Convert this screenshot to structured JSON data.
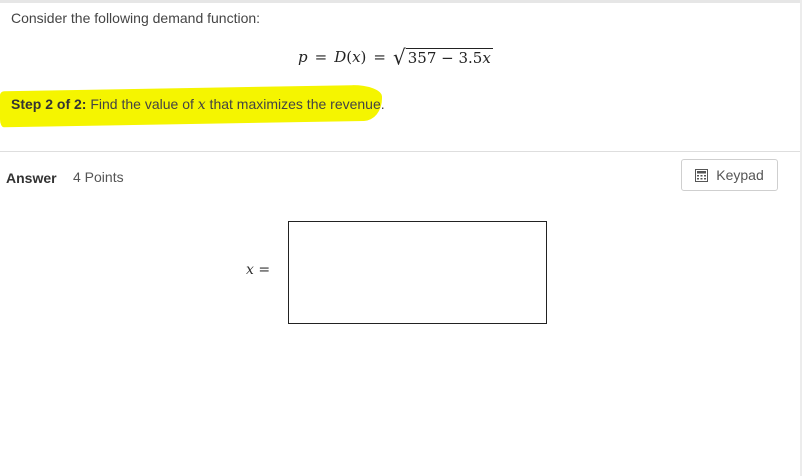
{
  "question": {
    "prompt": "Consider the following demand function:",
    "equation": {
      "p": "p",
      "eq1": "=",
      "func": "D",
      "arg_open": "(",
      "arg": "x",
      "arg_close": ")",
      "eq2": "=",
      "radicand_const": "357 − 3.5",
      "radicand_var": "x"
    }
  },
  "step": {
    "label": "Step 2 of 2:",
    "text_before": " Find the value of ",
    "variable": "x",
    "text_after": " that maximizes the revenue.",
    "highlight_color": "#f5f500"
  },
  "answer": {
    "label": "Answer",
    "points": "4 Points",
    "keypad_label": "Keypad",
    "variable": "x",
    "equals": "=",
    "input_value": ""
  }
}
